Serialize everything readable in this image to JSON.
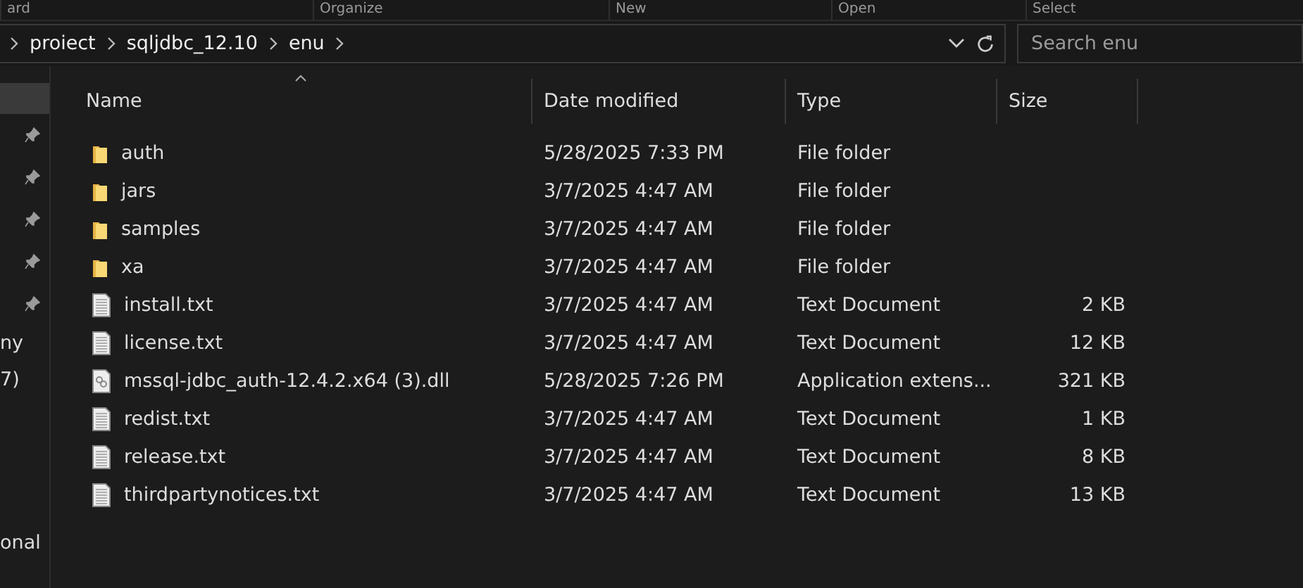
{
  "ribbon": {
    "groups": [
      "ard",
      "Organize",
      "New",
      "Open",
      "Select"
    ]
  },
  "address_bar": {
    "path": [
      "proiect",
      "sqljdbc_12.10",
      "enu"
    ]
  },
  "search": {
    "placeholder": "Search enu"
  },
  "sidebar": {
    "items": [
      {
        "kind": "blank",
        "selected": true
      },
      {
        "kind": "pin"
      },
      {
        "kind": "pin"
      },
      {
        "kind": "pin"
      },
      {
        "kind": "pin"
      },
      {
        "kind": "pin"
      },
      {
        "kind": "text",
        "label": "ny"
      },
      {
        "kind": "text",
        "label": "7)"
      },
      {
        "kind": "gap"
      },
      {
        "kind": "gap"
      },
      {
        "kind": "gap"
      },
      {
        "kind": "text",
        "label": "onal"
      }
    ]
  },
  "table": {
    "columns": [
      "Name",
      "Date modified",
      "Type",
      "Size"
    ],
    "rows": [
      {
        "kind": "folder",
        "name": "auth",
        "date": "5/28/2025 7:33 PM",
        "type": "File folder",
        "size": ""
      },
      {
        "kind": "folder",
        "name": "jars",
        "date": "3/7/2025 4:47 AM",
        "type": "File folder",
        "size": ""
      },
      {
        "kind": "folder",
        "name": "samples",
        "date": "3/7/2025 4:47 AM",
        "type": "File folder",
        "size": ""
      },
      {
        "kind": "folder",
        "name": "xa",
        "date": "3/7/2025 4:47 AM",
        "type": "File folder",
        "size": ""
      },
      {
        "kind": "text",
        "name": "install.txt",
        "date": "3/7/2025 4:47 AM",
        "type": "Text Document",
        "size": "2 KB"
      },
      {
        "kind": "text",
        "name": "license.txt",
        "date": "3/7/2025 4:47 AM",
        "type": "Text Document",
        "size": "12 KB"
      },
      {
        "kind": "dll",
        "name": "mssql-jdbc_auth-12.4.2.x64 (3).dll",
        "date": "5/28/2025 7:26 PM",
        "type": "Application extens...",
        "size": "321 KB"
      },
      {
        "kind": "text",
        "name": "redist.txt",
        "date": "3/7/2025 4:47 AM",
        "type": "Text Document",
        "size": "1 KB"
      },
      {
        "kind": "text",
        "name": "release.txt",
        "date": "3/7/2025 4:47 AM",
        "type": "Text Document",
        "size": "8 KB"
      },
      {
        "kind": "text",
        "name": "thirdpartynotices.txt",
        "date": "3/7/2025 4:47 AM",
        "type": "Text Document",
        "size": "13 KB"
      }
    ]
  }
}
